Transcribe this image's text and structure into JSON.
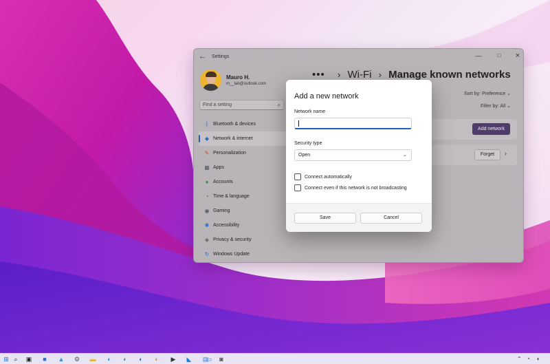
{
  "window": {
    "title": "Settings",
    "back": "←",
    "min": "—",
    "max": "□",
    "close": "×"
  },
  "user": {
    "name": "Mauro H.",
    "email": "m__lab@outlook.com"
  },
  "search": {
    "placeholder": "Find a setting",
    "icon": "⌕"
  },
  "sidebar": {
    "items": [
      {
        "label": "Bluetooth & devices",
        "icon": "bluetooth",
        "glyph": "ᛒ",
        "color": "#2b6cc4"
      },
      {
        "label": "Network & internet",
        "icon": "wifi",
        "glyph": "◆",
        "color": "#2b6cc4",
        "active": true
      },
      {
        "label": "Personalization",
        "icon": "brush",
        "glyph": "✎",
        "color": "#c7551c"
      },
      {
        "label": "Apps",
        "icon": "apps",
        "glyph": "▦",
        "color": "#555b66"
      },
      {
        "label": "Accounts",
        "icon": "person",
        "glyph": "●",
        "color": "#2f8f4a"
      },
      {
        "label": "Time & language",
        "icon": "globe",
        "glyph": "◔",
        "color": "#2b6cc4"
      },
      {
        "label": "Gaming",
        "icon": "gamepad",
        "glyph": "◉",
        "color": "#555b66"
      },
      {
        "label": "Accessibility",
        "icon": "accessibility",
        "glyph": "✱",
        "color": "#2b6cc4"
      },
      {
        "label": "Privacy & security",
        "icon": "shield",
        "glyph": "◈",
        "color": "#555b66"
      },
      {
        "label": "Windows Update",
        "icon": "update",
        "glyph": "↻",
        "color": "#2b6cc4"
      }
    ]
  },
  "header": {
    "dots": "•••",
    "sep": "›",
    "wifi": "Wi-Fi",
    "page": "Manage known networks"
  },
  "toolbar": {
    "sort_by": "Sort by: Preference ⌄",
    "filter_by": "Filter by: All ⌄",
    "add_network": "Add network",
    "forget": "Forget",
    "chevron": "›"
  },
  "dialog": {
    "title": "Add a new network",
    "network_name_label": "Network name",
    "network_name_value": "",
    "security_label": "Security type",
    "security_value": "Open",
    "security_chevron": "⌄",
    "connect_auto": "Connect automatically",
    "connect_hidden": "Connect even if this network is not broadcasting",
    "save": "Save",
    "cancel": "Cancel"
  },
  "taskbar": {
    "apps": [
      {
        "name": "start",
        "glyph": "⊞",
        "color": "#1f6fd1"
      },
      {
        "name": "search",
        "glyph": "⌕",
        "color": "#222222"
      },
      {
        "name": "task-view",
        "glyph": "▣",
        "color": "#222222"
      },
      {
        "name": "store",
        "glyph": "■",
        "color": "#2a6fc7"
      },
      {
        "name": "photos",
        "glyph": "▲",
        "color": "#3a8fd6"
      },
      {
        "name": "settings",
        "glyph": "⚙",
        "color": "#555555"
      },
      {
        "name": "file-explorer",
        "glyph": "▬",
        "color": "#e8b531"
      },
      {
        "name": "edge",
        "glyph": "◐",
        "color": "#1d8fd6"
      },
      {
        "name": "edge-beta",
        "glyph": "◐",
        "color": "#1c9a6e"
      },
      {
        "name": "edge-dev",
        "glyph": "◐",
        "color": "#1b6fb8"
      },
      {
        "name": "edge-canary",
        "glyph": "◐",
        "color": "#c99b22"
      },
      {
        "name": "terminal",
        "glyph": "▶",
        "color": "#333333"
      },
      {
        "name": "vscode",
        "glyph": "◣",
        "color": "#1f7ad1"
      },
      {
        "name": "notepad",
        "glyph": "▤",
        "color": "#3c86d8"
      },
      {
        "name": "remote-desktop",
        "glyph": "▭",
        "color": "#3a7bd5"
      },
      {
        "name": "camera",
        "glyph": "◙",
        "color": "#555555"
      }
    ],
    "tray": {
      "chevron": "⌃",
      "network": "◔",
      "volume": "◖"
    }
  }
}
